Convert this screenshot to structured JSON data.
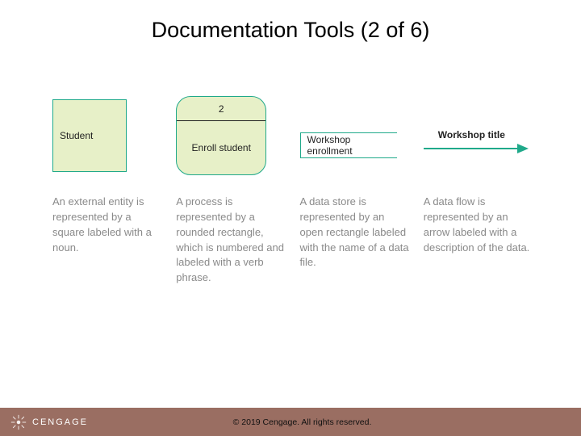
{
  "title": "Documentation Tools (2 of 6)",
  "items": [
    {
      "symbol_text": "Student",
      "desc": "An external entity is represented by a square labeled with a noun."
    },
    {
      "process_num": "2",
      "process_label": "Enroll student",
      "desc": "A process is represented by a rounded rectangle, which is numbered and labeled with a verb phrase."
    },
    {
      "store_label": "Workshop enrollment",
      "desc": "A data store is represented by an open rectangle labeled with the name of a data file."
    },
    {
      "flow_label": "Workshop title",
      "desc": "A data flow is represented by an arrow labeled with a description of the data."
    }
  ],
  "footer": {
    "brand": "CENGAGE",
    "copyright": "© 2019 Cengage. All rights reserved."
  },
  "colors": {
    "accent": "#1fa98a",
    "fill": "#e7f0c8",
    "footer_bg": "#9a6e62"
  }
}
